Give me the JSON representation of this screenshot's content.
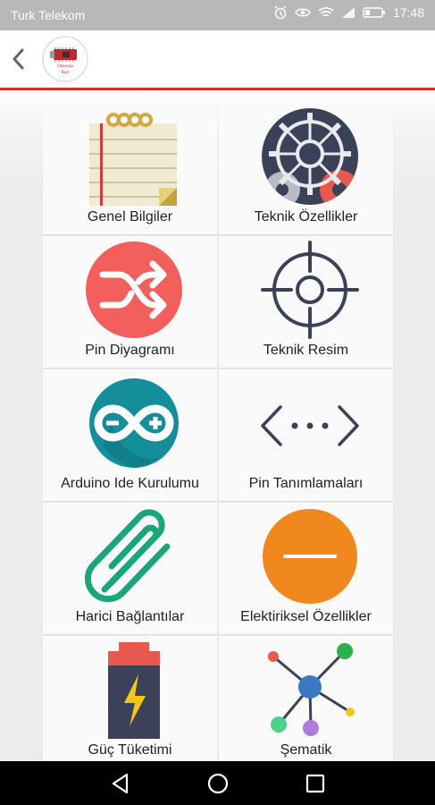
{
  "status_bar": {
    "carrier": "Turk Telekom",
    "time": "17:48",
    "icons": [
      "alarm-icon",
      "eye-comfort-icon",
      "wifi-icon",
      "signal-icon",
      "battery-icon"
    ]
  },
  "app_bar": {
    "back_icon": "chevron-left-icon",
    "logo_text_line1": "Deneyap",
    "logo_text_line2": "Kart",
    "accent_color": "#d32b2b"
  },
  "menu": {
    "items": [
      {
        "label": "Genel Bilgiler",
        "icon": "notepad-icon"
      },
      {
        "label": "Teknik Özellikler",
        "icon": "gears-icon"
      },
      {
        "label": "Pin Diyagramı",
        "icon": "shuffle-icon"
      },
      {
        "label": "Teknik Resim",
        "icon": "crosshair-icon"
      },
      {
        "label": "Arduino Ide Kurulumu",
        "icon": "arduino-icon"
      },
      {
        "label": "Pin Tanımlamaları",
        "icon": "code-dots-icon"
      },
      {
        "label": "Harici Bağlantılar",
        "icon": "paperclip-icon"
      },
      {
        "label": "Elektiriksel Özellikler",
        "icon": "minus-circle-icon"
      },
      {
        "label": "Güç Tüketimi",
        "icon": "battery-bolt-icon"
      },
      {
        "label": "Şematik",
        "icon": "network-icon"
      }
    ]
  },
  "nav_bar": {
    "icons": [
      "back-triangle-icon",
      "home-circle-icon",
      "recents-square-icon"
    ]
  }
}
